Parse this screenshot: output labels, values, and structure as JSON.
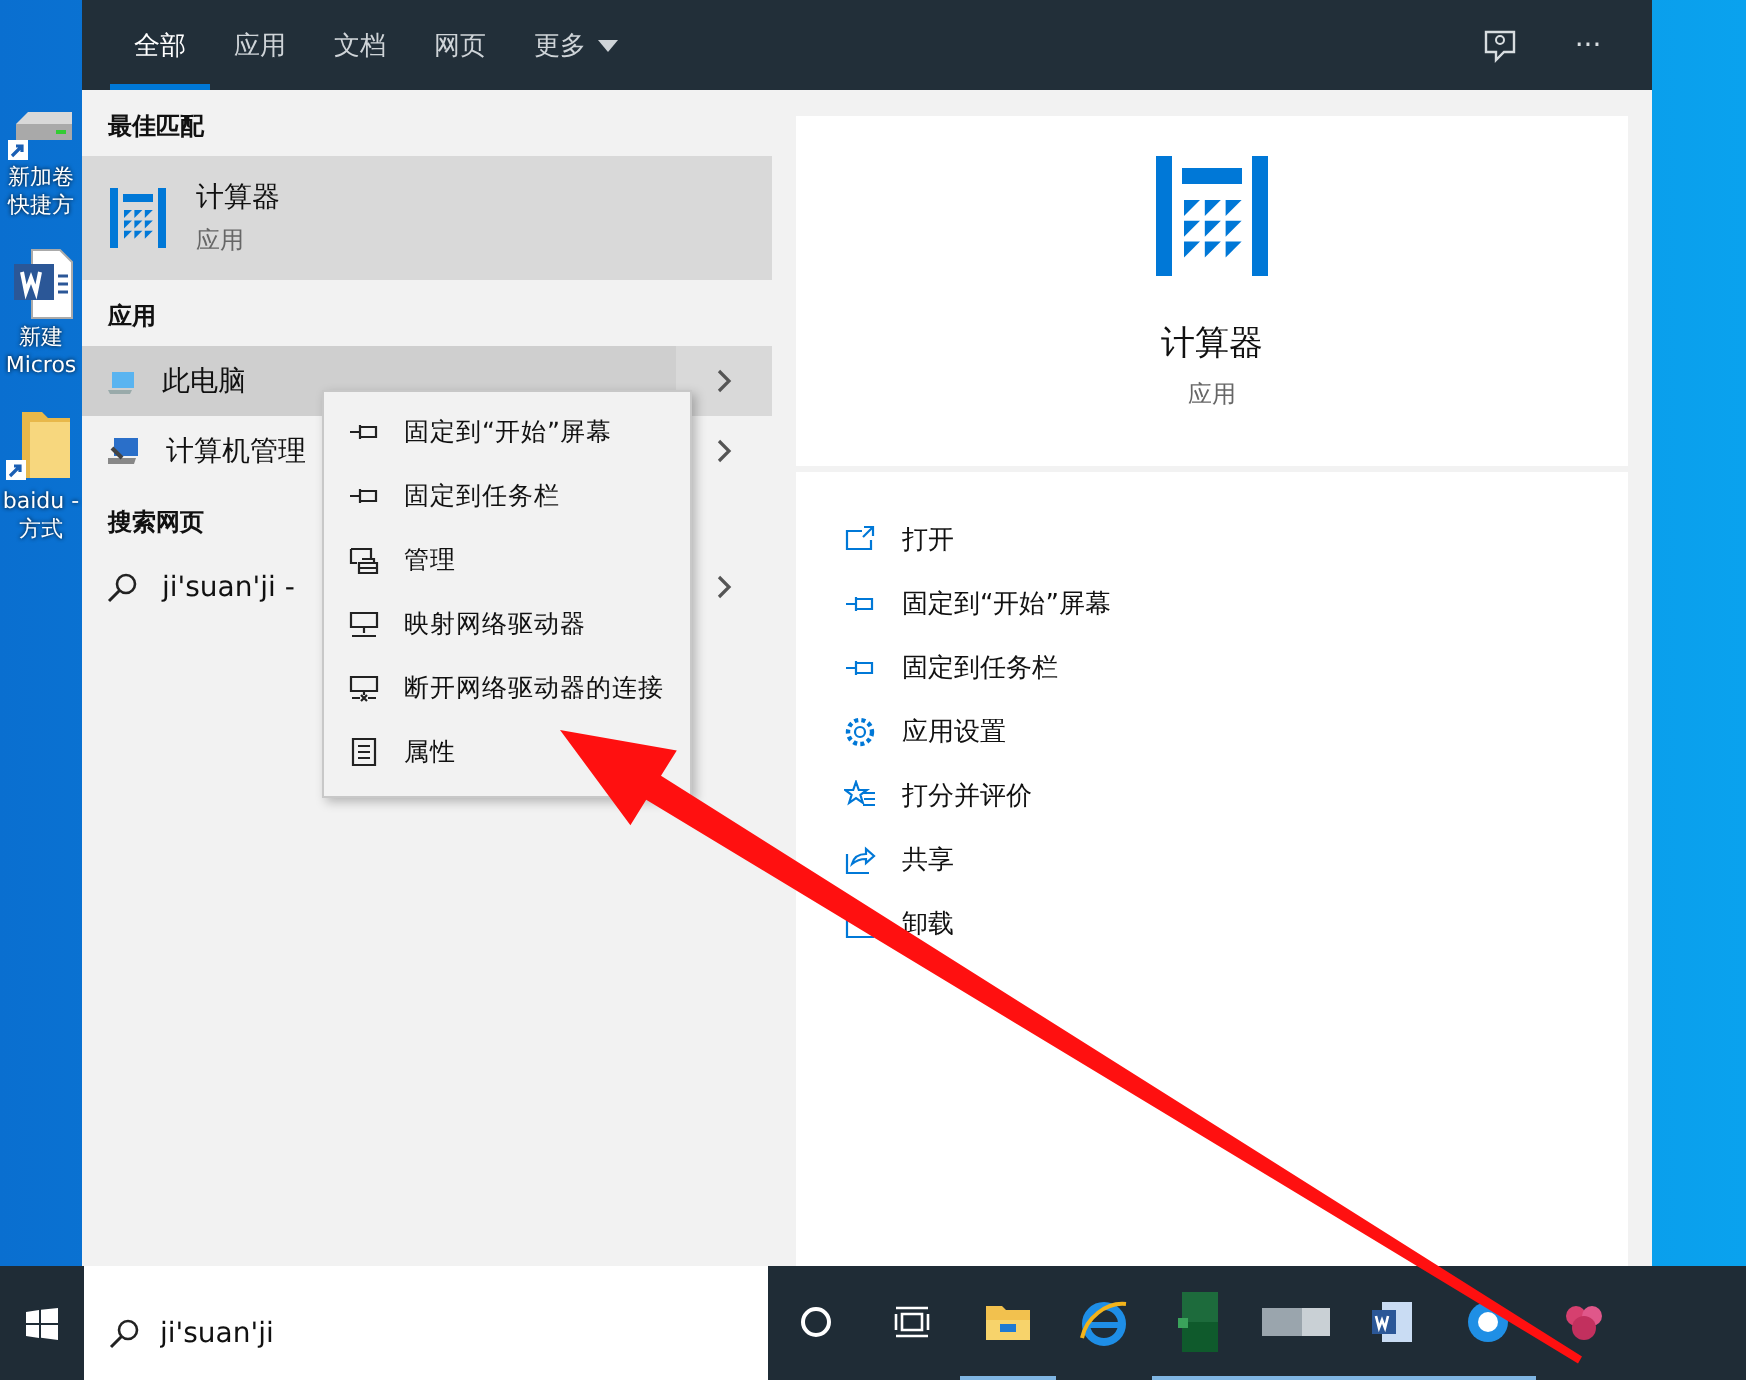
{
  "desktop_icons": [
    {
      "kind": "drive",
      "label_lines": [
        "新加卷",
        "快捷方"
      ]
    },
    {
      "kind": "document",
      "label_lines": [
        "新建",
        "Micros"
      ]
    },
    {
      "kind": "folder",
      "label_lines": [
        "baidu -",
        "方式"
      ]
    }
  ],
  "search_panel": {
    "tabs": [
      {
        "label": "全部",
        "selected": true,
        "has_menu": false
      },
      {
        "label": "应用",
        "selected": false,
        "has_menu": false
      },
      {
        "label": "文档",
        "selected": false,
        "has_menu": false
      },
      {
        "label": "网页",
        "selected": false,
        "has_menu": false
      },
      {
        "label": "更多",
        "selected": false,
        "has_menu": true
      }
    ],
    "more_button": "···",
    "best_match": {
      "heading": "最佳匹配",
      "title": "计算器",
      "subtitle": "应用",
      "selected": true
    },
    "apps": {
      "heading": "应用",
      "items": [
        {
          "kind": "computer",
          "label": "此电脑",
          "selected": true
        },
        {
          "kind": "management",
          "label": "计算机管理",
          "selected": false
        }
      ]
    },
    "web": {
      "heading": "搜索网页",
      "items": [
        {
          "kind": "search",
          "label": "ji'suan'ji -",
          "selected": false
        }
      ]
    },
    "context_menu": [
      {
        "kind": "pin",
        "label": "固定到“开始”屏幕"
      },
      {
        "kind": "pin",
        "label": "固定到任务栏"
      },
      {
        "kind": "manage",
        "label": "管理"
      },
      {
        "kind": "map-drive",
        "label": "映射网络驱动器"
      },
      {
        "kind": "disconnect",
        "label": "断开网络驱动器的连接"
      },
      {
        "kind": "properties",
        "label": "属性"
      }
    ],
    "detail": {
      "title": "计算器",
      "subtitle": "应用",
      "actions": [
        {
          "kind": "open",
          "label": "打开"
        },
        {
          "kind": "pin",
          "label": "固定到“开始”屏幕"
        },
        {
          "kind": "pin",
          "label": "固定到任务栏"
        },
        {
          "kind": "settings",
          "label": "应用设置"
        },
        {
          "kind": "rate",
          "label": "打分并评价"
        },
        {
          "kind": "share",
          "label": "共享"
        },
        {
          "kind": "uninstall",
          "label": "卸载"
        }
      ]
    }
  },
  "taskbar": {
    "search_value": "ji'suan'ji",
    "apps": [
      {
        "kind": "folder",
        "running": true
      },
      {
        "kind": "browser",
        "running": false
      },
      {
        "kind": "spreadsheet",
        "running": true
      },
      {
        "kind": "blurred",
        "running": true
      },
      {
        "kind": "word",
        "running": true
      },
      {
        "kind": "globe",
        "running": true
      },
      {
        "kind": "flower",
        "running": false
      }
    ]
  }
}
